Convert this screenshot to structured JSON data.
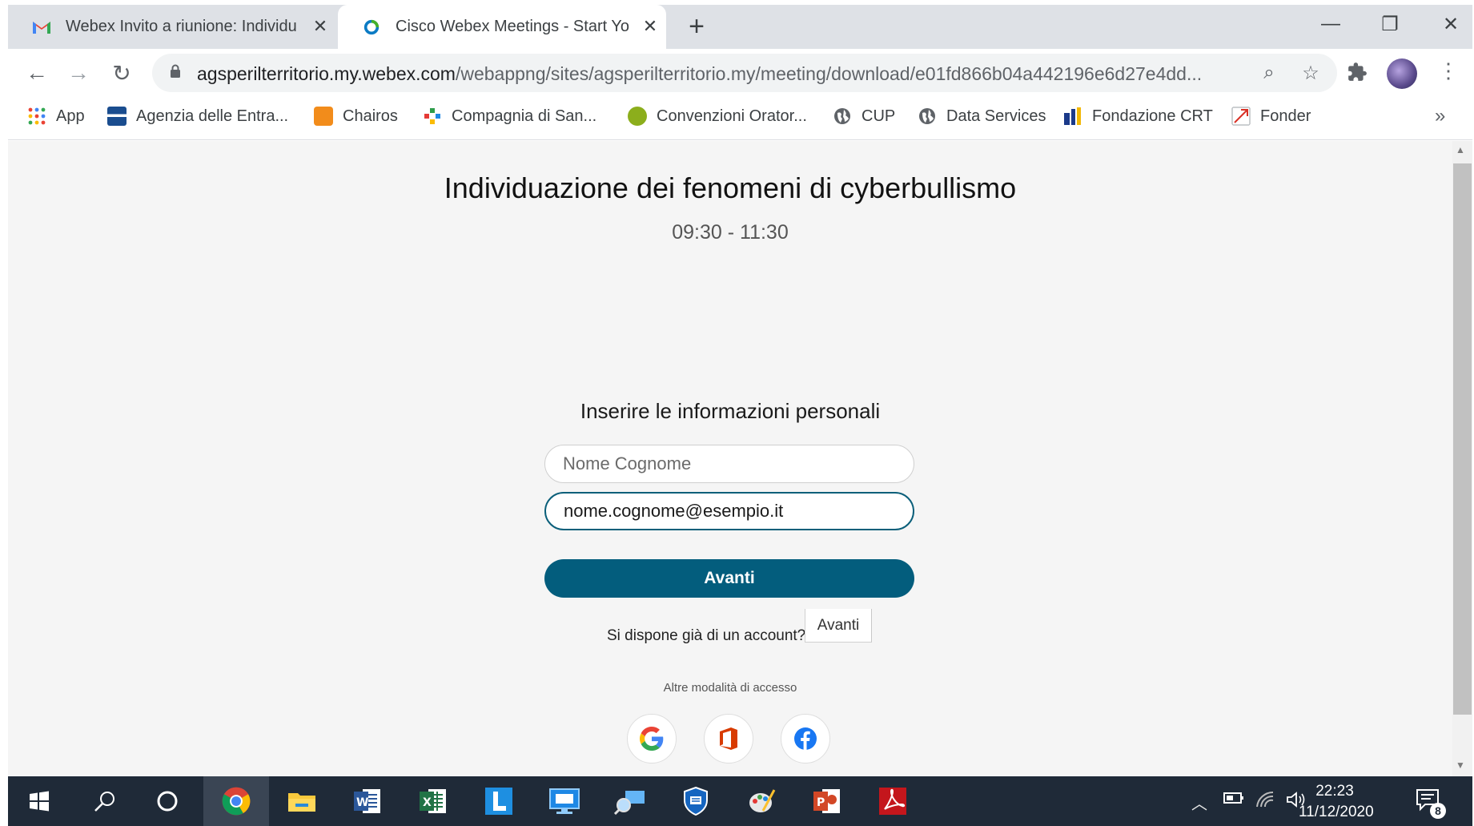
{
  "browser": {
    "tabs": [
      {
        "title": "Webex Invito a riunione: Individu",
        "active": false,
        "icon": "gmail-icon"
      },
      {
        "title": "Cisco Webex Meetings - Start Yo",
        "active": true,
        "icon": "webex-icon"
      }
    ],
    "new_tab": "+",
    "url_host": "agsperilterritorio.my.webex.com",
    "url_path": "/webappng/sites/agsperilterritorio.my/meeting/download/e01fd866b04a442196e6d27e4dd...",
    "bookmarks": [
      {
        "label": "App",
        "icon": "apps-grid-icon",
        "color": "#ea4335"
      },
      {
        "label": "Agenzia delle Entra...",
        "icon": "agenzia-icon",
        "color": "#1a4d8f"
      },
      {
        "label": "Chairos",
        "icon": "chairos-icon",
        "color": "#f28c1b"
      },
      {
        "label": "Compagnia di San...",
        "icon": "compagnia-icon",
        "color": "#2e9d4b"
      },
      {
        "label": "Convenzioni Orator...",
        "icon": "oratori-icon",
        "color": "#8cae1c"
      },
      {
        "label": "CUP",
        "icon": "globe-icon",
        "color": "#5f6368"
      },
      {
        "label": "Data Services",
        "icon": "globe-icon",
        "color": "#5f6368"
      },
      {
        "label": "Fondazione CRT",
        "icon": "fondazione-icon",
        "color": "#1b3a8a"
      },
      {
        "label": "Fonder",
        "icon": "fonder-icon",
        "color": "#d93025"
      }
    ],
    "bookmarks_more": "»"
  },
  "page": {
    "meeting_title": "Individuazione dei fenomeni di cyberbullismo",
    "meeting_time": "09:30 - 11:30",
    "form_heading": "Inserire le informazioni personali",
    "name_placeholder": "Nome Cognome",
    "email_value": "nome.cognome@esempio.it",
    "next_button": "Avanti",
    "account_question": "Si dispone già di un account?",
    "signin_button": "Avanti",
    "other_access": "Altre modalità di accesso",
    "social": [
      "google-icon",
      "office-icon",
      "facebook-icon"
    ]
  },
  "taskbar": {
    "time": "22:23",
    "date": "11/12/2020",
    "notifications": "8"
  },
  "colors": {
    "accent": "#035d7d",
    "page_bg": "#f5f5f5",
    "taskbar_bg": "#1f2a38"
  }
}
